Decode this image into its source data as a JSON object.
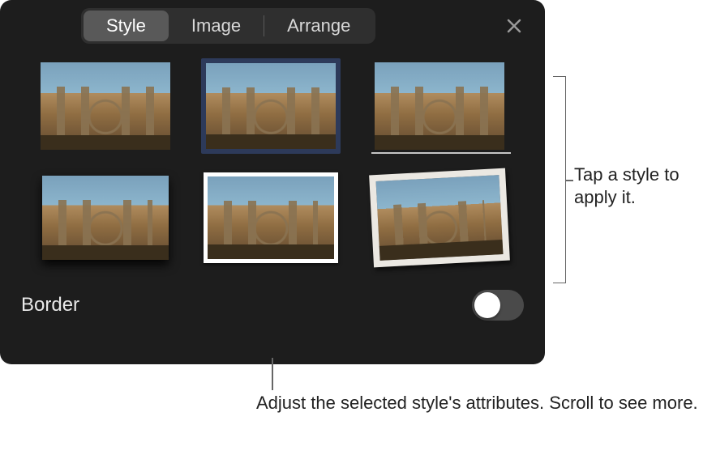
{
  "tabs": {
    "style": "Style",
    "image": "Image",
    "arrange": "Arrange"
  },
  "border": {
    "label": "Border"
  },
  "callouts": {
    "top": "Tap a style to apply it.",
    "bottom": "Adjust the selected style's attributes. Scroll to see more."
  },
  "styles": {
    "items": [
      "plain",
      "dark-frame",
      "reflection",
      "drop-shadow",
      "white-border",
      "polaroid"
    ],
    "selected_index": 1
  },
  "toggle": {
    "border_on": false
  }
}
